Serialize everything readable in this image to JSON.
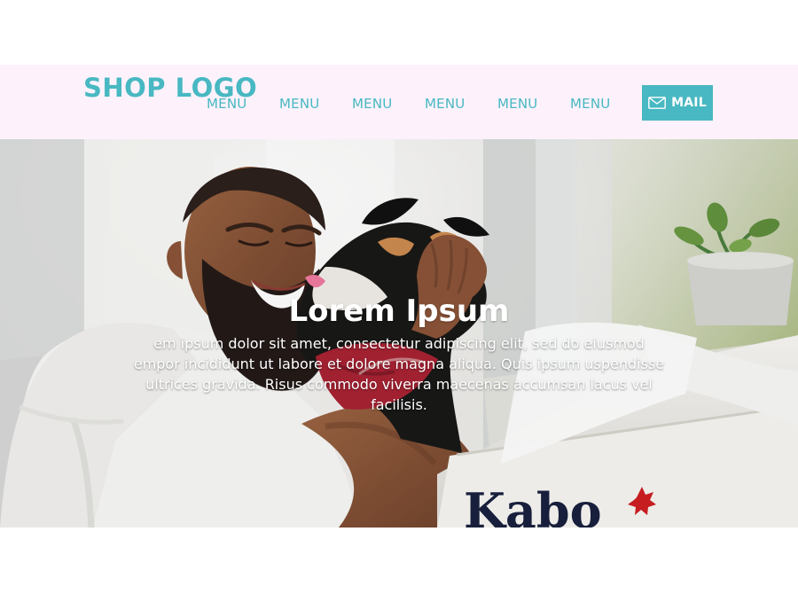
{
  "header": {
    "logo": "SHOP LOGO",
    "menu_items": [
      "MENU",
      "MENU",
      "MENU",
      "MENU",
      "MENU",
      "MENU"
    ],
    "mail_button": {
      "label": "MAIL",
      "icon": "mail-icon"
    }
  },
  "hero": {
    "title": "Lorem Ipsum",
    "body": "em ipsum dolor sit amet, consectetur adipiscing elit, sed do eiusmod empor incididunt ut labore et dolore magna aliqua. Quis ipsum uspendisse ultrices gravida. Risus commodo viverra maecenas accumsan lacus vel facilisis.",
    "photo_brand_text": "Kabo"
  },
  "colors": {
    "accent": "#48b8c2",
    "header_background": "#fdf2fb",
    "page_background": "#ffffff"
  }
}
